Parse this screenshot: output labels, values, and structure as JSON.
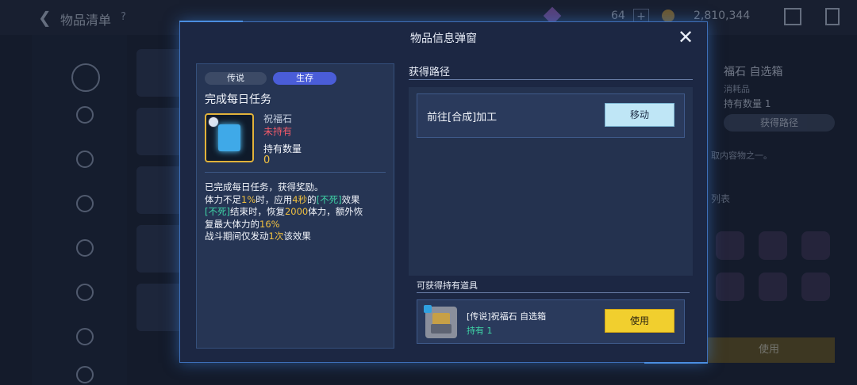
{
  "background": {
    "title": "物品清单",
    "help": "?",
    "gem_count": "64",
    "plus": "+",
    "coins": "2,810,344",
    "right_panel": {
      "item_title": "福石 自选箱",
      "item_type": "消耗品",
      "own_label": "持有数量 1",
      "route_button": "获得路径",
      "desc": "取内容物之一。",
      "list_label": "列表",
      "use_button": "使用"
    }
  },
  "modal": {
    "title": "物品信息弹窗",
    "close": "✕",
    "tags": [
      "传说",
      "生存"
    ],
    "card_title": "完成每日任务",
    "item_name": "祝福石",
    "item_status": "未持有",
    "qty_label": "持有数量",
    "qty_value": "0",
    "description": {
      "line1": "已完成每日任务，获得奖励。",
      "line2_a": "体力不足",
      "line2_b": "1%",
      "line2_c": "时，应用",
      "line2_d": "4秒",
      "line2_e": "的",
      "line2_f": "[不死]",
      "line2_g": "效果",
      "line3_a": "[不死]",
      "line3_b": "结束时，恢复",
      "line3_c": "2000",
      "line3_d": "体力，额外恢",
      "line4_a": "复最大体力的",
      "line4_b": "16%",
      "line5_a": "战斗期间仅发动",
      "line5_b": "1次",
      "line5_c": "该效果"
    },
    "routes_title": "获得路径",
    "route_label": "前往[合成]加工",
    "move_button": "移动",
    "obtain_title": "可获得持有道具",
    "obtain_name": "[传说]祝福石 自选箱",
    "obtain_own": "持有 1",
    "use_button": "使用"
  }
}
